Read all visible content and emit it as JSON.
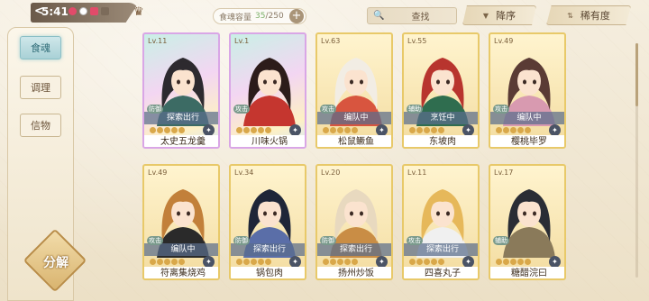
{
  "topbar": {
    "time": "5:41",
    "capacity_label": "食魂容量",
    "capacity_current": "35",
    "capacity_total": "/250",
    "search_label": "查找",
    "sort_order": "降序",
    "sort_key": "稀有度"
  },
  "sidebar": {
    "tabs": [
      "食魂",
      "调理",
      "信物"
    ],
    "decompose_label": "分解"
  },
  "cards": [
    {
      "level": "Lv.11",
      "badge": "探索出行",
      "role": "防御",
      "name": "太史五龙羹",
      "stars": 5,
      "frame": "rainbow",
      "hair": "#2d2a2f",
      "accent": "#3c6b64"
    },
    {
      "level": "Lv.1",
      "badge": "",
      "role": "攻击",
      "name": "川味火锅",
      "stars": 5,
      "frame": "rainbow",
      "hair": "#2c1c1a",
      "accent": "#c5362f"
    },
    {
      "level": "Lv.63",
      "badge": "编队中",
      "role": "攻击",
      "name": "松鼠鳜鱼",
      "stars": 5,
      "frame": "gold",
      "hair": "#f2ede4",
      "accent": "#d8553f"
    },
    {
      "level": "Lv.55",
      "badge": "烹饪中",
      "role": "辅助",
      "name": "东坡肉",
      "stars": 5,
      "frame": "gold",
      "hair": "#b8342e",
      "accent": "#2f6d4f"
    },
    {
      "level": "Lv.49",
      "badge": "编队中",
      "role": "攻击",
      "name": "樱桃毕罗",
      "stars": 5,
      "frame": "gold",
      "hair": "#5a3b35",
      "accent": "#d89ab0"
    },
    {
      "level": "Lv.49",
      "badge": "编队中",
      "role": "攻击",
      "name": "符离集烧鸡",
      "stars": 5,
      "frame": "gold",
      "hair": "#c2803a",
      "accent": "#2a2a2a"
    },
    {
      "level": "Lv.34",
      "badge": "探索出行",
      "role": "防御",
      "name": "锅包肉",
      "stars": 5,
      "frame": "gold",
      "hair": "#1f2638",
      "accent": "#5a6ea8"
    },
    {
      "level": "Lv.20",
      "badge": "探索出行",
      "role": "防御",
      "name": "扬州炒饭",
      "stars": 5,
      "frame": "gold",
      "hair": "#e8d9bf",
      "accent": "#c98d45"
    },
    {
      "level": "Lv.11",
      "badge": "探索出行",
      "role": "攻击",
      "name": "四喜丸子",
      "stars": 5,
      "frame": "gold",
      "hair": "#e6b85a",
      "accent": "#f0f0f0"
    },
    {
      "level": "Lv.17",
      "badge": "",
      "role": "辅助",
      "name": "糖醋浣曰",
      "stars": 5,
      "frame": "gold",
      "hair": "#2a2d35",
      "accent": "#8a7a5a"
    }
  ]
}
